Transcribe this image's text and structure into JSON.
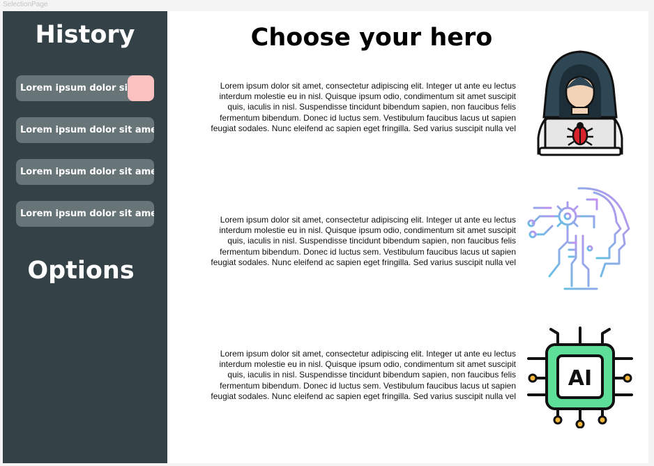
{
  "frame": {
    "label": "SelectionPage"
  },
  "sidebar": {
    "history_title": "History",
    "options_title": "Options",
    "history_items": [
      {
        "label": "Lorem ipsum dolor sit ..."
      },
      {
        "label": "Lorem ipsum dolor sit amet ..."
      },
      {
        "label": "Lorem ipsum dolor sit amet ..."
      },
      {
        "label": "Lorem ipsum dolor sit amet ..."
      }
    ]
  },
  "main": {
    "title": "Choose your hero",
    "heroes": [
      {
        "icon": "hacker-icon",
        "description": [
          "Lorem ipsum dolor sit amet, consectetur adipiscing elit. Integer ut ante  eu lectus",
          "interdum molestie eu in nisl. Quisque ipsum odio, condimentum  sit amet suscipit",
          "quis, iaculis in nisl. Suspendisse tincidunt bibendum  sapien, non faucibus felis",
          "fermentum bibendum. Donec id luctus sem.  Vestibulum faucibus lacus ut sapien",
          "feugiat sodales. Nunc eleifend ac  sapien eget fringilla. Sed varius suscipit nulla vel"
        ]
      },
      {
        "icon": "ai-head-icon",
        "description": [
          "Lorem ipsum dolor sit amet, consectetur adipiscing elit. Integer ut ante  eu lectus",
          "interdum molestie eu in nisl. Quisque ipsum odio, condimentum  sit amet suscipit",
          "quis, iaculis in nisl. Suspendisse tincidunt bibendum  sapien, non faucibus felis",
          "fermentum bibendum. Donec id luctus sem.  Vestibulum faucibus lacus ut sapien",
          "feugiat sodales. Nunc eleifend ac  sapien eget fringilla. Sed varius suscipit nulla vel"
        ]
      },
      {
        "icon": "ai-chip-icon",
        "chip_label": "AI",
        "description": [
          "Lorem ipsum dolor sit amet, consectetur adipiscing elit. Integer ut ante  eu lectus",
          "interdum molestie eu in nisl. Quisque ipsum odio, condimentum  sit amet suscipit",
          "quis, iaculis in nisl. Suspendisse tincidunt bibendum  sapien, non faucibus felis",
          "fermentum bibendum. Donec id luctus sem.  Vestibulum faucibus lacus ut sapien",
          "feugiat sodales. Nunc eleifend ac  sapien eget fringilla. Sed varius suscipit nulla vel"
        ]
      }
    ]
  },
  "colors": {
    "sidebar_bg": "#344147",
    "history_item_bg": "#677478",
    "history_item_accent": "#fbc1c1",
    "chip_green": "#5ddf9a",
    "gradient_start": "#5bc6e0",
    "gradient_end": "#c78ef0"
  }
}
